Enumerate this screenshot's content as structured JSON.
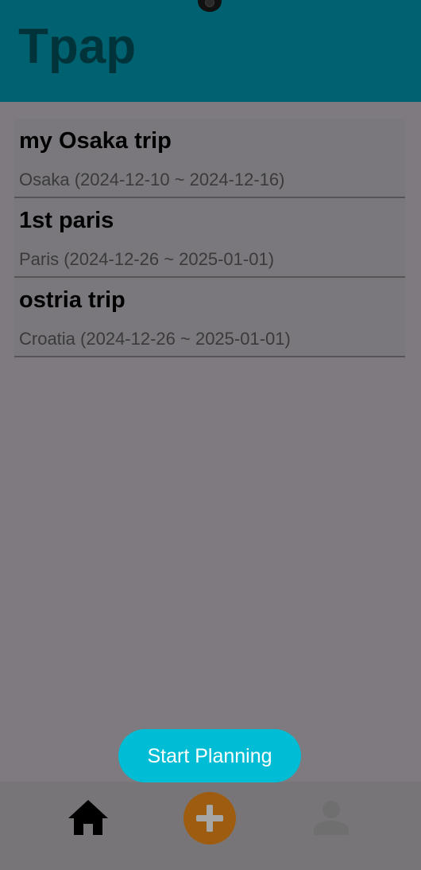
{
  "app": {
    "title": "Tpap"
  },
  "trips": [
    {
      "name": "my Osaka trip",
      "detail": "Osaka (2024-12-10 ~ 2024-12-16)"
    },
    {
      "name": "1st paris",
      "detail": "Paris (2024-12-26 ~ 2025-01-01)"
    },
    {
      "name": "ostria trip",
      "detail": "Croatia (2024-12-26 ~ 2025-01-01)"
    }
  ],
  "actions": {
    "start_planning_label": "Start Planning"
  },
  "nav": {
    "items": [
      {
        "icon": "home-icon"
      },
      {
        "icon": "plus-icon",
        "color": "#9e5c10"
      },
      {
        "icon": "person-icon"
      }
    ]
  },
  "colors": {
    "header": "#006170",
    "accent": "#00bcd4",
    "background": "#7f7a7f"
  }
}
